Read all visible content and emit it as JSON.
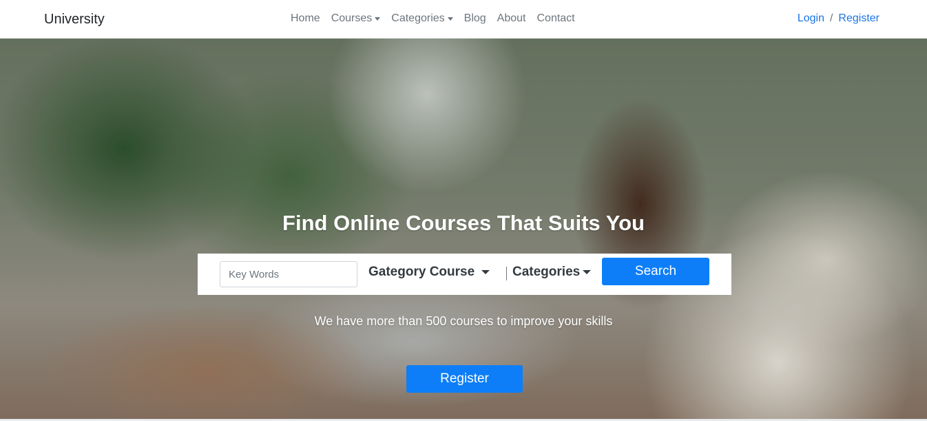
{
  "navbar": {
    "brand": "University",
    "links": [
      {
        "label": "Home",
        "dropdown": false
      },
      {
        "label": "Courses",
        "dropdown": true
      },
      {
        "label": "Categories",
        "dropdown": true
      },
      {
        "label": "Blog",
        "dropdown": false
      },
      {
        "label": "About",
        "dropdown": false
      },
      {
        "label": "Contact",
        "dropdown": false
      }
    ],
    "auth": {
      "login": "Login",
      "separator": "/",
      "register": "Register"
    }
  },
  "hero": {
    "title": "Find Online Courses That Suits You",
    "search": {
      "keyword_placeholder": "Key Words",
      "keyword_value": "",
      "category_course_label": "Gategory Course",
      "categories_label": "Categories",
      "search_button": "Search"
    },
    "subtitle": "We have more than 500 courses to improve your skills",
    "register_button": "Register"
  },
  "colors": {
    "primary": "#0d7ef7",
    "link": "#1a73e8",
    "nav_text": "#6c757d",
    "brand_text": "#212529"
  }
}
